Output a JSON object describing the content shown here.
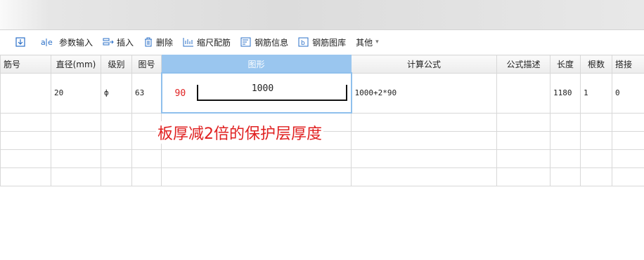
{
  "toolbar": {
    "items": [
      {
        "label": "",
        "icon": "arrow-down-box-icon"
      },
      {
        "label": "参数输入",
        "icon": "abc-param-icon"
      },
      {
        "label": "插入",
        "icon": "insert-icon"
      },
      {
        "label": "删除",
        "icon": "trash-icon"
      },
      {
        "label": "缩尺配筋",
        "icon": "scale-rebar-icon"
      },
      {
        "label": "钢筋信息",
        "icon": "rebar-info-icon"
      },
      {
        "label": "钢筋图库",
        "icon": "rebar-library-icon"
      },
      {
        "label": "其他",
        "icon": "caret-down-icon"
      }
    ]
  },
  "table": {
    "headers": [
      "筋号",
      "直径(mm)",
      "级别",
      "图号",
      "图形",
      "计算公式",
      "公式描述",
      "长度",
      "根数",
      "搭接"
    ],
    "row": {
      "bar_no": "",
      "diameter": "20",
      "grade": "ф",
      "shape_no": "63",
      "shape_left": "90",
      "shape_mid": "1000",
      "formula": "1000+2*90",
      "description": "",
      "length": "1180",
      "count": "1",
      "lap": "0"
    }
  },
  "annotation": "板厚减2倍的保护层厚度",
  "colors": {
    "annotation": "#e02020",
    "selected_header": "#9ac6ef",
    "accent_icon": "#2a6fc7"
  }
}
